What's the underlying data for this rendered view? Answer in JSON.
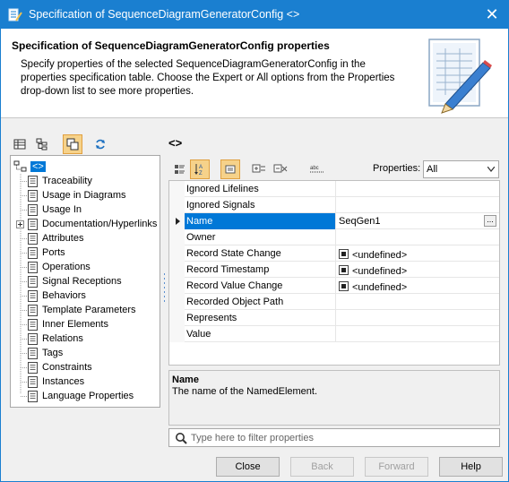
{
  "window": {
    "title": "Specification of SequenceDiagramGeneratorConfig <>",
    "close_glyph": "✕"
  },
  "header": {
    "title": "Specification of SequenceDiagramGeneratorConfig properties",
    "description": "Specify properties of the selected SequenceDiagramGeneratorConfig in the properties specification table. Choose the Expert or All options from the Properties drop-down list to see more properties.",
    "icon": "document-pencil-icon"
  },
  "left_toolbar": {
    "icons": [
      "table-icon",
      "tree-icon",
      "copy-icon",
      "refresh-icon"
    ]
  },
  "tree": {
    "root_label": "<>",
    "items": [
      {
        "label": "Traceability",
        "expandable": false
      },
      {
        "label": "Usage in Diagrams",
        "expandable": false
      },
      {
        "label": "Usage In",
        "expandable": false
      },
      {
        "label": "Documentation/Hyperlinks",
        "expandable": true
      },
      {
        "label": "Attributes",
        "expandable": false
      },
      {
        "label": "Ports",
        "expandable": false
      },
      {
        "label": "Operations",
        "expandable": false
      },
      {
        "label": "Signal Receptions",
        "expandable": false
      },
      {
        "label": "Behaviors",
        "expandable": false
      },
      {
        "label": "Template Parameters",
        "expandable": false
      },
      {
        "label": "Inner Elements",
        "expandable": false
      },
      {
        "label": "Relations",
        "expandable": false
      },
      {
        "label": "Tags",
        "expandable": false
      },
      {
        "label": "Constraints",
        "expandable": false
      },
      {
        "label": "Instances",
        "expandable": false
      },
      {
        "label": "Language Properties",
        "expandable": false
      }
    ]
  },
  "element_title": "<>",
  "properties_toolbar": {
    "icons": [
      "categorize-icon",
      "sort-az-icon",
      "collapse-icon",
      "expand-all-icon",
      "collapse-all-icon",
      "spellcheck-icon"
    ],
    "properties_label": "Properties:",
    "properties_value": "All"
  },
  "grid": {
    "rows": [
      {
        "name": "Ignored Lifelines",
        "value": "",
        "checkbox": false,
        "selected": false
      },
      {
        "name": "Ignored Signals",
        "value": "",
        "checkbox": false,
        "selected": false
      },
      {
        "name": "Name",
        "value": "SeqGen1",
        "checkbox": false,
        "selected": true
      },
      {
        "name": "Owner",
        "value": "",
        "checkbox": false,
        "selected": false
      },
      {
        "name": "Record State Change",
        "value": "<undefined>",
        "checkbox": true,
        "selected": false
      },
      {
        "name": "Record Timestamp",
        "value": "<undefined>",
        "checkbox": true,
        "selected": false
      },
      {
        "name": "Record Value Change",
        "value": "<undefined>",
        "checkbox": true,
        "selected": false
      },
      {
        "name": "Recorded Object Path",
        "value": "",
        "checkbox": false,
        "selected": false
      },
      {
        "name": "Represents",
        "value": "",
        "checkbox": false,
        "selected": false
      },
      {
        "name": "Value",
        "value": "",
        "checkbox": false,
        "selected": false
      }
    ],
    "ellipsis_label": "..."
  },
  "description_panel": {
    "title": "Name",
    "text": "The name of the NamedElement."
  },
  "filter": {
    "placeholder": "Type here to filter properties"
  },
  "footer": {
    "close": "Close",
    "back": "Back",
    "forward": "Forward",
    "help": "Help"
  },
  "colors": {
    "titlebar": "#1a7fd0",
    "selection": "#0078d7",
    "active_tool": "#f6d28a"
  }
}
